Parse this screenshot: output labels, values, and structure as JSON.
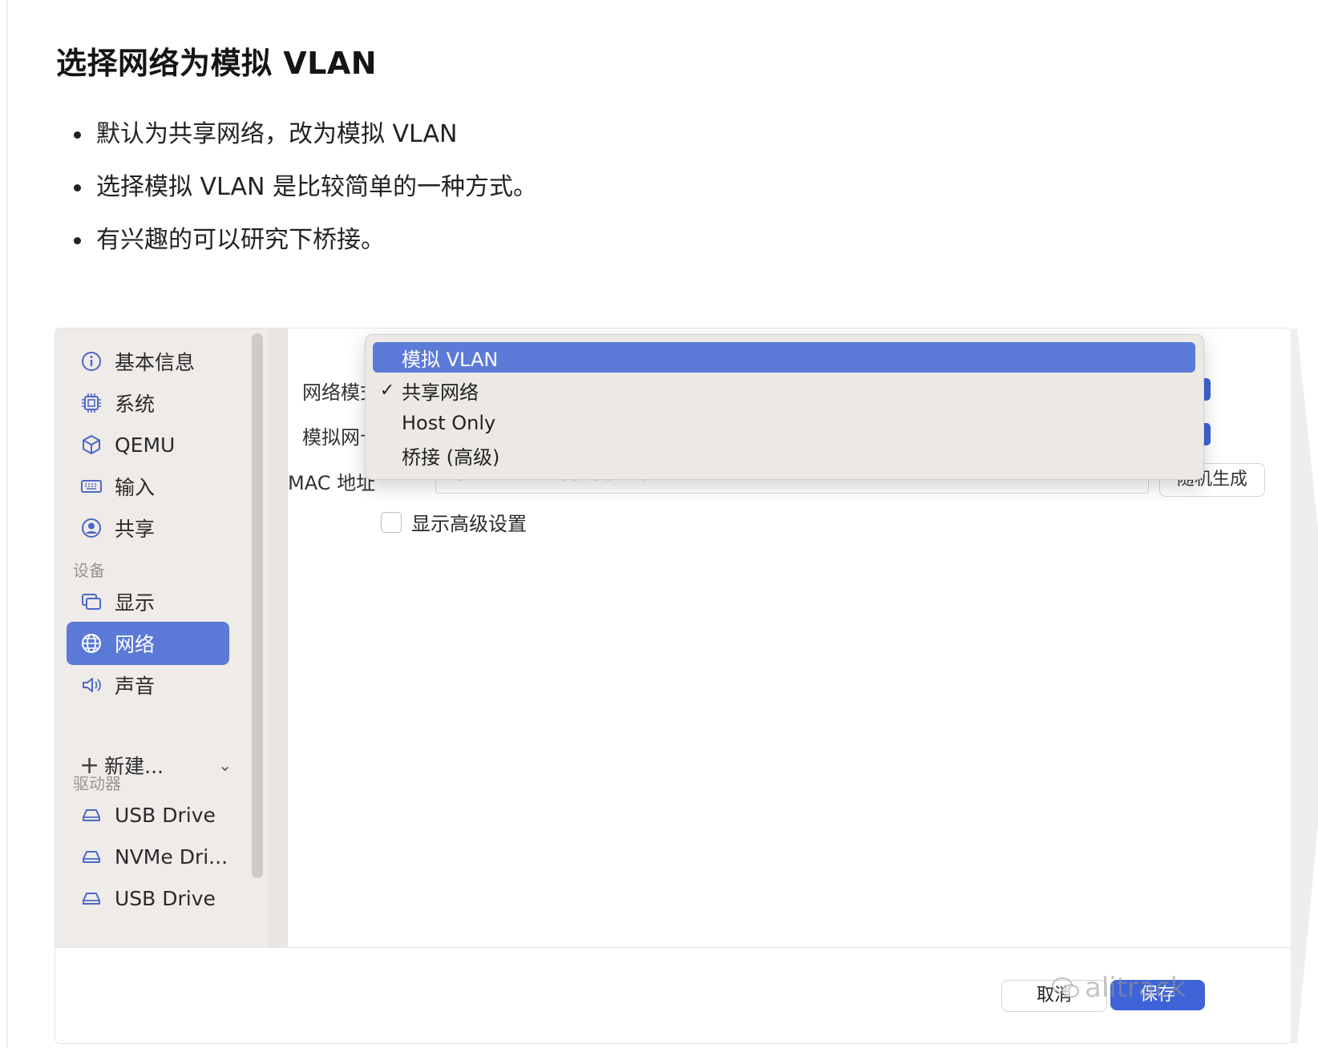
{
  "article": {
    "heading": "选择网络为模拟 VLAN",
    "bullets": [
      "默认为共享网络，改为模拟 VLAN",
      "选择模拟 VLAN 是比较简单的一种方式。",
      "有兴趣的可以研究下桥接。"
    ]
  },
  "sidebar": {
    "items": [
      {
        "label": "基本信息",
        "icon": "info-icon"
      },
      {
        "label": "系统",
        "icon": "chip-icon"
      },
      {
        "label": "QEMU",
        "icon": "cube-icon"
      },
      {
        "label": "输入",
        "icon": "keyboard-icon"
      },
      {
        "label": "共享",
        "icon": "person-circle-icon"
      }
    ],
    "devices_header": "设备",
    "devices": [
      {
        "label": "显示",
        "icon": "display-icon"
      },
      {
        "label": "网络",
        "icon": "globe-icon",
        "active": true
      },
      {
        "label": "声音",
        "icon": "speaker-icon"
      }
    ],
    "new_label": "新建...",
    "drives_header": "驱动器",
    "drives": [
      {
        "label": "USB Drive",
        "icon": "drive-icon"
      },
      {
        "label": "NVMe Dri...",
        "icon": "drive-icon"
      },
      {
        "label": "USB Drive",
        "icon": "drive-icon"
      }
    ]
  },
  "form": {
    "network_mode_label": "网络模式",
    "emulated_nic_label": "模拟网卡",
    "mac_label": "MAC 地址",
    "mac_value": "52:A7:4E:C9:55:B0",
    "random_button": "随机生成",
    "advanced_checkbox": "显示高级设置",
    "advanced_checked": false
  },
  "dropdown": {
    "options": [
      "模拟 VLAN",
      "共享网络",
      "Host Only",
      "桥接 (高级)"
    ],
    "highlighted": "模拟 VLAN",
    "checked": "共享网络"
  },
  "footer": {
    "cancel_label": "取消",
    "save_label": "保存"
  },
  "watermark": {
    "text": "alitrack"
  },
  "colors": {
    "accent": "#5b79d6",
    "button_blue": "#3e63d6",
    "sidebar_bg": "#efebe9",
    "menu_bg": "#ece9e5"
  }
}
